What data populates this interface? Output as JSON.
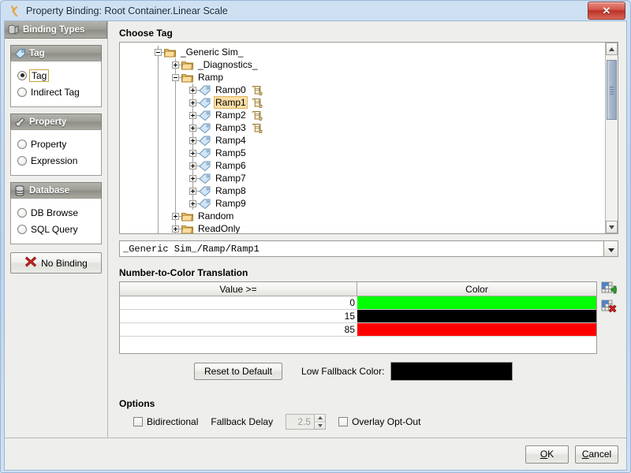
{
  "window": {
    "title": "Property Binding: Root Container.Linear Scale",
    "icon": "wrench-icon",
    "close_label": "✕"
  },
  "sidebar": {
    "header": {
      "label": "Binding Types",
      "icon": "binding-types-icon"
    },
    "groups": [
      {
        "label": "Tag",
        "icon": "tag-icon",
        "options": [
          {
            "label": "Tag",
            "selected": true,
            "focused": true
          },
          {
            "label": "Indirect Tag",
            "selected": false,
            "focused": false
          }
        ]
      },
      {
        "label": "Property",
        "icon": "property-icon",
        "options": [
          {
            "label": "Property",
            "selected": false,
            "focused": false
          },
          {
            "label": "Expression",
            "selected": false,
            "focused": false
          }
        ]
      },
      {
        "label": "Database",
        "icon": "database-icon",
        "options": [
          {
            "label": "DB Browse",
            "selected": false,
            "focused": false
          },
          {
            "label": "SQL Query",
            "selected": false,
            "focused": false
          }
        ]
      }
    ],
    "no_binding_label": "No Binding"
  },
  "choose_tag": {
    "title": "Choose Tag",
    "tree": [
      {
        "label": "_Generic Sim_",
        "depth": 1,
        "type": "folder",
        "expander": "minus",
        "scroll": false,
        "selected": false
      },
      {
        "label": "_Diagnostics_",
        "depth": 2,
        "type": "folder",
        "expander": "plus",
        "scroll": false,
        "selected": false
      },
      {
        "label": "Ramp",
        "depth": 2,
        "type": "folder",
        "expander": "minus",
        "scroll": false,
        "selected": false
      },
      {
        "label": "Ramp0",
        "depth": 3,
        "type": "tag",
        "expander": "plus",
        "scroll": true,
        "selected": false
      },
      {
        "label": "Ramp1",
        "depth": 3,
        "type": "tag",
        "expander": "plus",
        "scroll": true,
        "selected": true
      },
      {
        "label": "Ramp2",
        "depth": 3,
        "type": "tag",
        "expander": "plus",
        "scroll": true,
        "selected": false
      },
      {
        "label": "Ramp3",
        "depth": 3,
        "type": "tag",
        "expander": "plus",
        "scroll": true,
        "selected": false
      },
      {
        "label": "Ramp4",
        "depth": 3,
        "type": "tag",
        "expander": "plus",
        "scroll": false,
        "selected": false
      },
      {
        "label": "Ramp5",
        "depth": 3,
        "type": "tag",
        "expander": "plus",
        "scroll": false,
        "selected": false
      },
      {
        "label": "Ramp6",
        "depth": 3,
        "type": "tag",
        "expander": "plus",
        "scroll": false,
        "selected": false
      },
      {
        "label": "Ramp7",
        "depth": 3,
        "type": "tag",
        "expander": "plus",
        "scroll": false,
        "selected": false
      },
      {
        "label": "Ramp8",
        "depth": 3,
        "type": "tag",
        "expander": "plus",
        "scroll": false,
        "selected": false
      },
      {
        "label": "Ramp9",
        "depth": 3,
        "type": "tag",
        "expander": "plus",
        "scroll": false,
        "selected": false
      },
      {
        "label": "Random",
        "depth": 2,
        "type": "folder",
        "expander": "plus",
        "scroll": false,
        "selected": false
      },
      {
        "label": "ReadOnly",
        "depth": 2,
        "type": "folder",
        "expander": "plus",
        "scroll": false,
        "selected": false
      }
    ],
    "path_value": "_Generic Sim_/Ramp/Ramp1",
    "path_dropdown_icon": "chevron-down-icon"
  },
  "translation": {
    "title": "Number-to-Color Translation",
    "columns": [
      "Value >=",
      "Color"
    ],
    "rows": [
      {
        "value": "0",
        "color": "#00FF00"
      },
      {
        "value": "15",
        "color": "#000000"
      },
      {
        "value": "85",
        "color": "#FF0000"
      }
    ],
    "add_row_icon": "add-row-icon",
    "delete_row_icon": "delete-row-icon",
    "reset_label": "Reset to Default",
    "low_fallback_label": "Low Fallback Color:",
    "low_fallback_color": "#000000"
  },
  "options": {
    "title": "Options",
    "bidirectional": {
      "label": "Bidirectional",
      "checked": false
    },
    "fallback_delay": {
      "label": "Fallback Delay",
      "value": "2.5",
      "enabled": false
    },
    "overlay_opt_out": {
      "label": "Overlay Opt-Out",
      "checked": false
    }
  },
  "footer": {
    "ok_label": "OK",
    "cancel_label": "Cancel"
  }
}
